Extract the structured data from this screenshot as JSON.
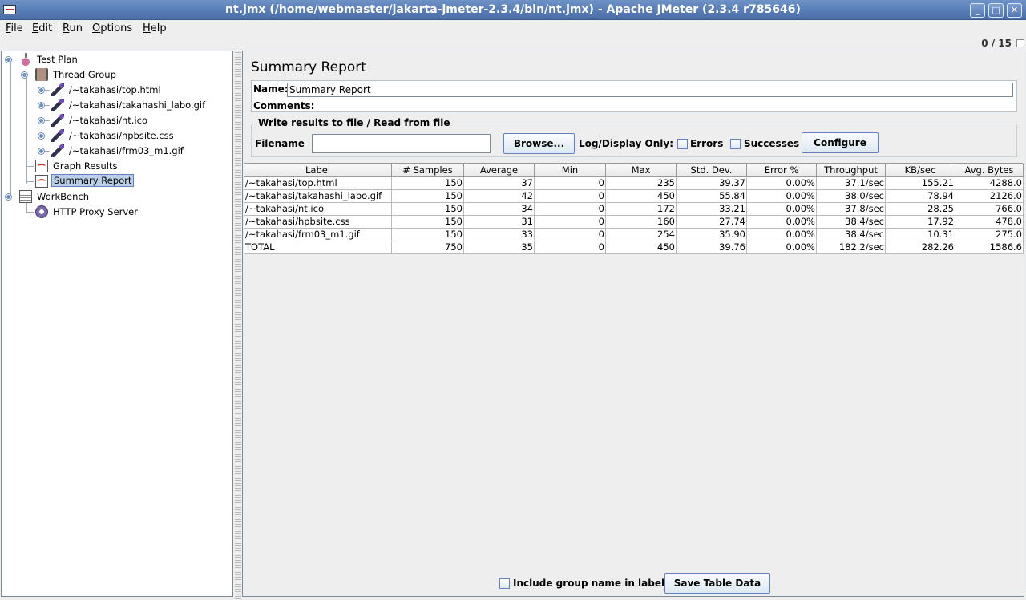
{
  "window": {
    "title": "nt.jmx (/home/webmaster/jakarta-jmeter-2.3.4/bin/nt.jmx) - Apache JMeter (2.3.4 r785646)"
  },
  "menu": [
    {
      "mn": "F",
      "rest": "ile"
    },
    {
      "mn": "E",
      "rest": "dit"
    },
    {
      "mn": "R",
      "rest": "un"
    },
    {
      "mn": "O",
      "rest": "ptions"
    },
    {
      "mn": "H",
      "rest": "elp"
    }
  ],
  "counter": "0 / 15",
  "tree": {
    "test_plan": "Test Plan",
    "thread_group": "Thread Group",
    "samplers": [
      "/~takahasi/top.html",
      "/~takahasi/takahashi_labo.gif",
      "/~takahasi/nt.ico",
      "/~takahasi/hpbsite.css",
      "/~takahasi/frm03_m1.gif"
    ],
    "graph_results": "Graph Results",
    "summary_report": "Summary Report",
    "workbench": "WorkBench",
    "proxy": "HTTP Proxy Server"
  },
  "panel": {
    "title": "Summary Report",
    "name_label": "Name:",
    "name_value": "Summary Report",
    "comments_label": "Comments:",
    "file_legend": "Write results to file / Read from file",
    "filename_label": "Filename",
    "browse_label": "Browse...",
    "log_display_label": "Log/Display Only:",
    "errors_label": "Errors",
    "successes_label": "Successes",
    "configure_label": "Configure"
  },
  "table": {
    "headers": [
      "Label",
      "# Samples",
      "Average",
      "Min",
      "Max",
      "Std. Dev.",
      "Error %",
      "Throughput",
      "KB/sec",
      "Avg. Bytes"
    ],
    "rows": [
      [
        "/~takahasi/top.html",
        "150",
        "37",
        "0",
        "235",
        "39.37",
        "0.00%",
        "37.1/sec",
        "155.21",
        "4288.0"
      ],
      [
        "/~takahasi/takahashi_labo.gif",
        "150",
        "42",
        "0",
        "450",
        "55.84",
        "0.00%",
        "38.0/sec",
        "78.94",
        "2126.0"
      ],
      [
        "/~takahasi/nt.ico",
        "150",
        "34",
        "0",
        "172",
        "33.21",
        "0.00%",
        "37.8/sec",
        "28.25",
        "766.0"
      ],
      [
        "/~takahasi/hpbsite.css",
        "150",
        "31",
        "0",
        "160",
        "27.74",
        "0.00%",
        "38.4/sec",
        "17.92",
        "478.0"
      ],
      [
        "/~takahasi/frm03_m1.gif",
        "150",
        "33",
        "0",
        "254",
        "35.90",
        "0.00%",
        "38.4/sec",
        "10.31",
        "275.0"
      ],
      [
        "TOTAL",
        "750",
        "35",
        "0",
        "450",
        "39.76",
        "0.00%",
        "182.2/sec",
        "282.26",
        "1586.6"
      ]
    ]
  },
  "bottom": {
    "include_group_label": "Include group name in label?",
    "save_table_label": "Save Table Data"
  }
}
